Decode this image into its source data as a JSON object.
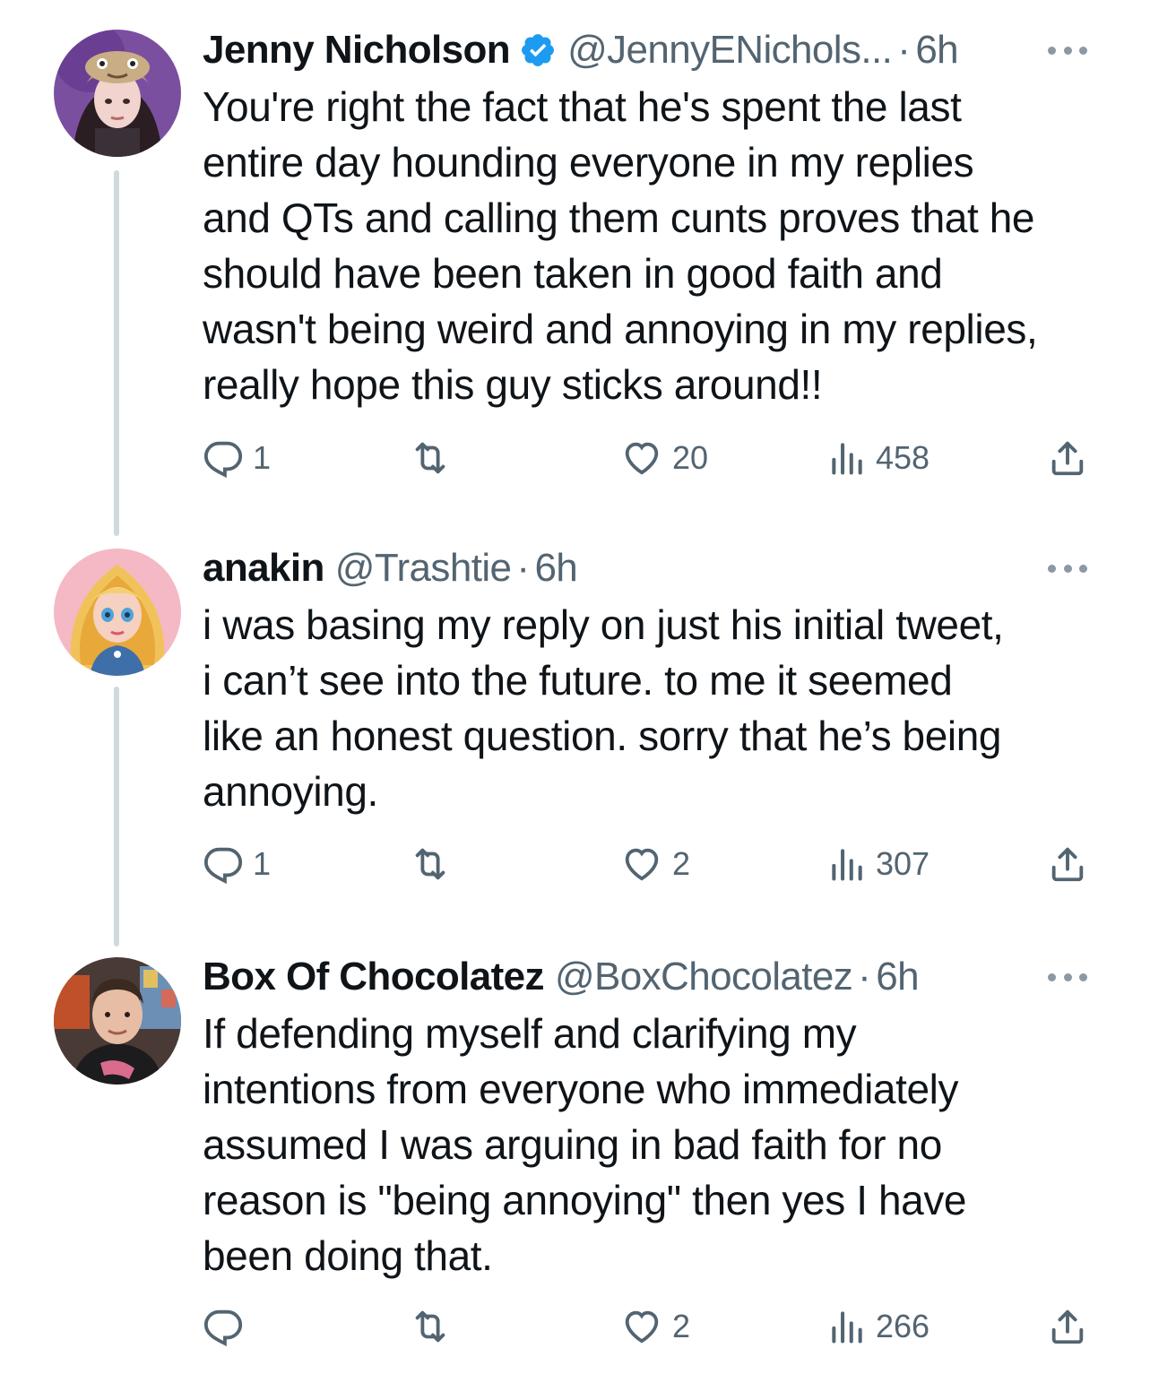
{
  "tweets": [
    {
      "name": "Jenny Nicholson",
      "verified": true,
      "handle": "@JennyENichols...",
      "separator": "·",
      "time": "6h",
      "text": "You're right the fact that he's spent the last\nentire day hounding everyone in my replies\nand QTs and calling them cunts proves that he\nshould have been taken in good faith and\nwasn't being weird and annoying in my replies,\nreally hope this guy sticks around!!",
      "replies": "1",
      "retweets": "",
      "likes": "20",
      "views": "458"
    },
    {
      "name": "anakin",
      "verified": false,
      "handle": "@Trashtie",
      "separator": "·",
      "time": "6h",
      "text": "i was basing my reply on just his initial tweet,\ni can’t see into the future. to me it seemed\nlike an honest question. sorry that he’s being\nannoying.",
      "replies": "1",
      "retweets": "",
      "likes": "2",
      "views": "307"
    },
    {
      "name": "Box Of Chocolatez",
      "verified": false,
      "handle": "@BoxChocolatez",
      "separator": "·",
      "time": "6h",
      "text": "If defending myself and clarifying my\nintentions from everyone who immediately\nassumed I was arguing in bad faith for no\nreason is \"being annoying\" then yes I have\nbeen doing that.",
      "replies": "",
      "retweets": "",
      "likes": "2",
      "views": "266"
    }
  ],
  "icons": {
    "reply": "reply-icon",
    "retweet": "retweet-icon",
    "like": "heart-icon",
    "views": "views-icon",
    "share": "share-icon",
    "more": "more-icon",
    "verified": "verified-badge-icon"
  },
  "colors": {
    "text": "#0f1419",
    "secondary": "#536471",
    "verified": "#1d9bf0",
    "thread_line": "#cfd9de"
  }
}
